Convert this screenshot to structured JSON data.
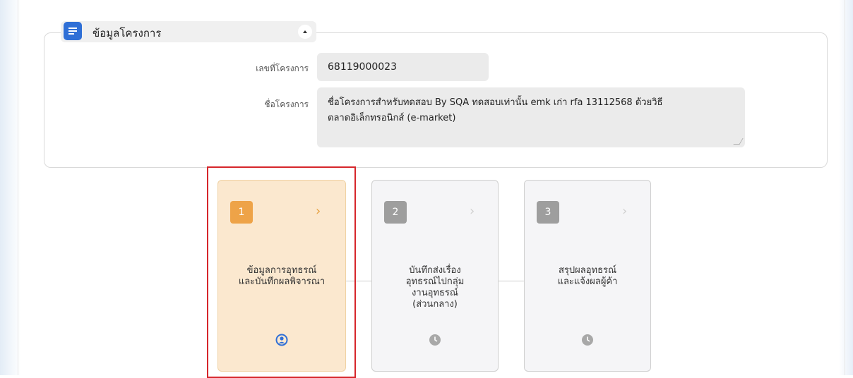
{
  "project_section": {
    "title": "ข้อมูลโครงการ",
    "icon": "list-icon",
    "collapse_icon": "caret-up-icon",
    "project_number_label": "เลขที่โครงการ",
    "project_number_value": "68119000023",
    "project_name_label": "ชื่อโครงการ",
    "project_name_line1": "ชื่อโครงการสำหรับทดสอบ By SQA ทดสอบเท่านั้น emk เก่า rfa 13112568 ด้วยวิธี",
    "project_name_line2": "ตลาดอิเล็กทรอนิกส์ (e-market)"
  },
  "steps": [
    {
      "number": "1",
      "label": "ข้อมูลการอุทธรณ์\nและบันทึกผลพิจารณา",
      "status_icon": "user-circle-icon",
      "state": "active"
    },
    {
      "number": "2",
      "label": "บันทึกส่งเรื่อง\nอุทธรณ์ไปกลุ่ม\nงานอุทธรณ์\n(ส่วนกลาง)",
      "status_icon": "clock-icon",
      "state": "pending"
    },
    {
      "number": "3",
      "label": "สรุปผลอุทธรณ์\nและแจ้งผลผู้ค้า",
      "status_icon": "clock-icon",
      "state": "pending"
    }
  ],
  "colors": {
    "accent_blue": "#2f6fd6",
    "active_step_bg": "#fbe8cf",
    "active_step_number": "#eea348",
    "inactive_step_number": "#9e9e9e",
    "highlight_border": "#d6262b"
  }
}
